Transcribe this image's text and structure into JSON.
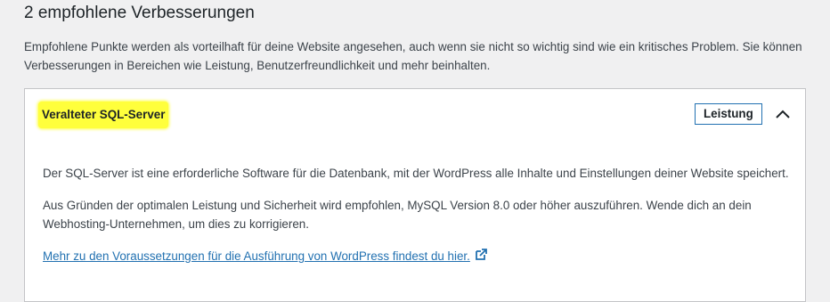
{
  "section": {
    "title": "2 empfohlene Verbesserungen",
    "description": "Empfohlene Punkte werden als vorteilhaft für deine Website angesehen, auch wenn sie nicht so wichtig sind wie ein kritisches Problem. Sie können Verbesserungen in Bereichen wie Leistung, Benutzerfreundlichkeit und mehr beinhalten."
  },
  "issue": {
    "title": "Veralteter SQL-Server",
    "badge": "Leistung",
    "badge_color": "#2271b1",
    "highlight_color": "#ffff3c",
    "toggle_icon": "chevron-up-icon",
    "paragraphs": [
      "Der SQL-Server ist eine erforderliche Software für die Datenbank, mit der WordPress alle Inhalte und Einstellungen deiner Website speichert.",
      "Aus Gründen der optimalen Leistung und Sicherheit wird empfohlen, MySQL Version 8.0 oder höher auszuführen. Wende dich an dein Webhosting-Unternehmen, um dies zu korrigieren."
    ],
    "link_text": "Mehr zu den Voraussetzungen für die Ausführung von WordPress findest du hier.",
    "link_icon": "external-link-icon",
    "link_color": "#2271b1"
  }
}
